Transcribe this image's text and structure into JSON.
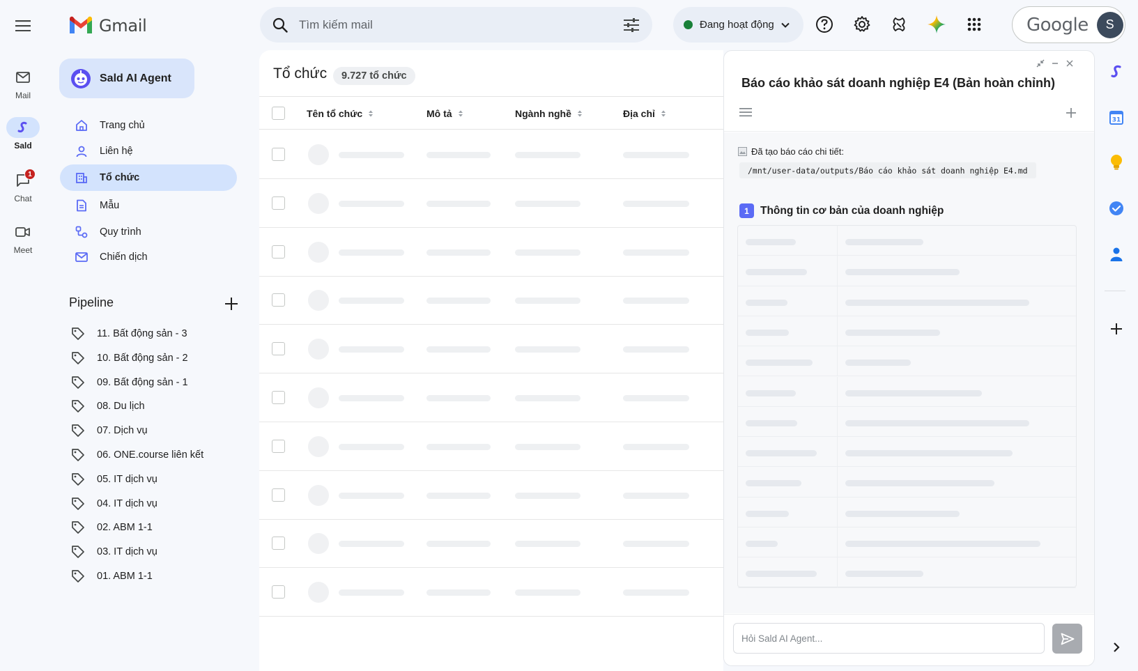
{
  "rail": {
    "items": [
      {
        "id": "mail",
        "label": "Mail",
        "icon": "mail-icon",
        "active": false
      },
      {
        "id": "sald",
        "label": "Sald",
        "icon": "sald-icon",
        "active": true
      },
      {
        "id": "chat",
        "label": "Chat",
        "icon": "chat-icon",
        "active": false,
        "badge": "1"
      },
      {
        "id": "meet",
        "label": "Meet",
        "icon": "video-icon",
        "active": false
      }
    ]
  },
  "brand": {
    "name": "Gmail"
  },
  "search": {
    "placeholder": "Tìm kiếm mail",
    "value": ""
  },
  "status": {
    "label": "Đang hoạt động",
    "color": "#188038"
  },
  "account": {
    "brand": "Google",
    "avatar_letter": "S"
  },
  "agent_button": {
    "label": "Sald AI Agent"
  },
  "nav": {
    "items": [
      {
        "label": "Trang chủ",
        "icon": "home-icon"
      },
      {
        "label": "Liên hệ",
        "icon": "person-icon"
      },
      {
        "label": "Tổ chức",
        "icon": "building-icon",
        "active": true
      },
      {
        "label": "Mẫu",
        "icon": "document-icon"
      },
      {
        "label": "Quy trình",
        "icon": "workflow-icon"
      },
      {
        "label": "Chiến dịch",
        "icon": "envelope-icon"
      }
    ]
  },
  "pipeline": {
    "title": "Pipeline",
    "items": [
      "11. Bất động sản - 3",
      "10. Bất động sản - 2",
      "09. Bất động sản - 1",
      "08. Du lịch",
      "07. Dịch vụ",
      "06. ONE.course liên kết",
      "05. IT dịch vụ",
      "04. IT dịch vụ",
      "02. ABM 1-1",
      "03. IT dịch vụ",
      "01. ABM 1-1"
    ]
  },
  "main": {
    "title": "Tổ chức",
    "count": "9.727 tổ chức",
    "columns": [
      "Tên tổ chức",
      "Mô tả",
      "Ngành nghề",
      "Địa chỉ"
    ],
    "loading_rows": 10
  },
  "panel": {
    "title": "Báo cáo khảo sát doanh nghiệp E4 (Bản hoàn chỉnh)",
    "report_note": "Đã tạo báo cáo chi tiết:",
    "report_path": "/mnt/user-data/outputs/Báo cáo khảo sát doanh nghiệp E4.md",
    "section_number": "1",
    "section_title": "Thông tin cơ bản của doanh nghiệp",
    "loading_rows": 12,
    "input_placeholder": "Hỏi Sald AI Agent..."
  },
  "addons": [
    "sald-addon-icon",
    "calendar-icon",
    "keep-icon",
    "tasks-icon",
    "contacts-icon",
    "add-addon-icon",
    "expand-chevron-icon"
  ],
  "colors": {
    "accent": "#d3e3fd",
    "badge": "#c5221f",
    "section_badge": "#5b6bf5"
  }
}
